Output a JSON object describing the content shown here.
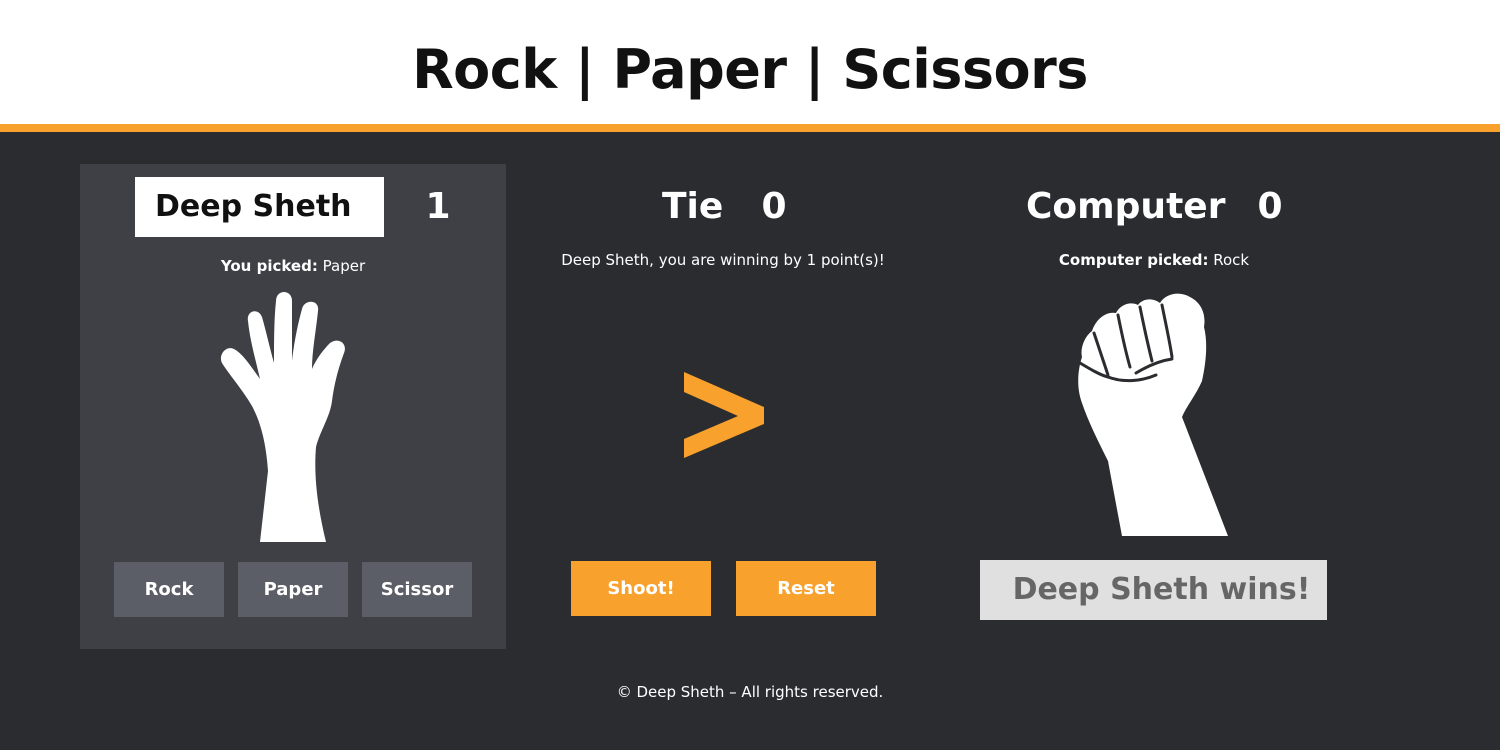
{
  "title": "Rock | Paper | Scissors",
  "player": {
    "name_value": "Deep Sheth",
    "score": "1",
    "picked_label": "You picked:",
    "picked_value": "Paper",
    "hand_icon": "open-hand-paper-icon",
    "choices": [
      "Rock",
      "Paper",
      "Scissor"
    ]
  },
  "tie": {
    "label": "Tie",
    "score": "0",
    "message": "Deep Sheth, you are winning by 1 point(s)!",
    "comparison_icon": "greater-than-icon"
  },
  "actions": {
    "shoot_label": "Shoot!",
    "reset_label": "Reset"
  },
  "computer": {
    "label": "Computer",
    "score": "0",
    "picked_label": "Computer picked:",
    "picked_value": "Rock",
    "hand_icon": "fist-rock-icon"
  },
  "result": "Deep Sheth wins!",
  "footer": "© Deep Sheth – All rights reserved.",
  "colors": {
    "accent": "#f9a12d",
    "background": "#2b2c30",
    "panel": "#3f4046",
    "choice_button": "#5b5e66",
    "result_box": "#e0e0e0"
  }
}
